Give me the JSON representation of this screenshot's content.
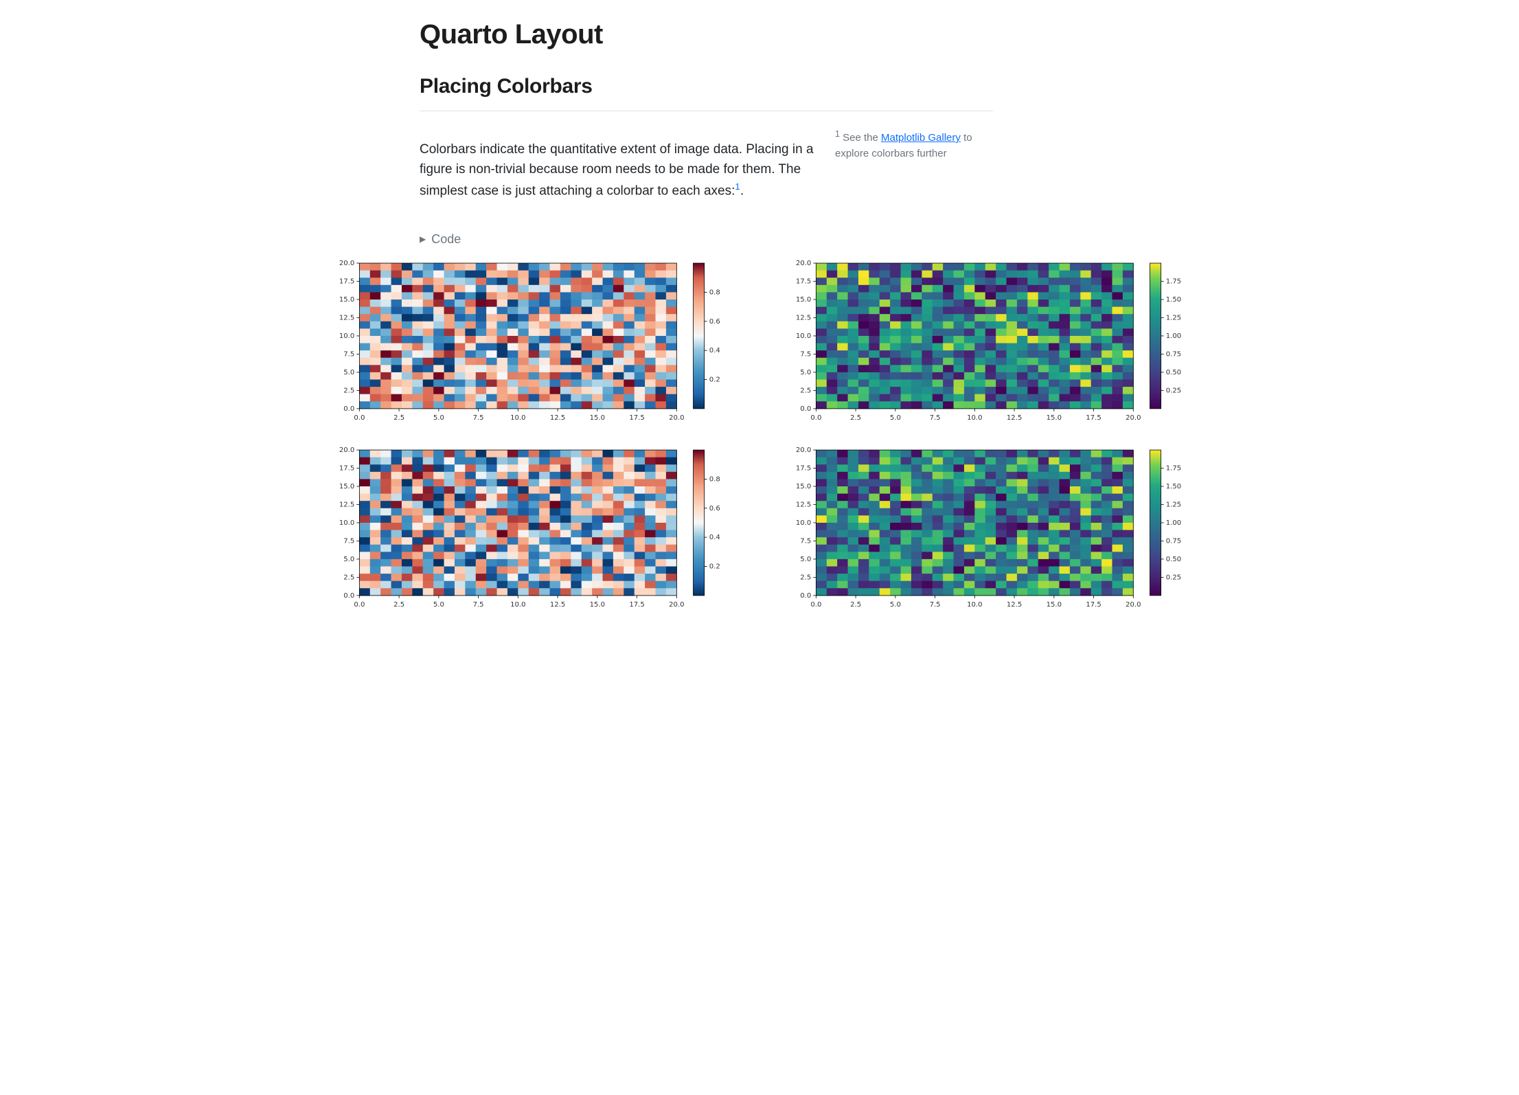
{
  "title": "Quarto Layout",
  "section": "Placing Colorbars",
  "paragraph_a": "Colorbars indicate the quantitative extent of image data. Placing in a figure is non-trivial because room needs to be made for them. The simplest case is just attaching a colorbar to each axes:",
  "footnote_marker": "1",
  "paragraph_b_after_marker": ".",
  "margin_note_prefix": "See the ",
  "margin_note_link": "Matplotlib Gallery",
  "margin_note_suffix": " to explore colorbars further",
  "code_toggle": "Code",
  "chart_data": [
    {
      "type": "heatmap",
      "position": "top-left",
      "colormap": "RdBu_r",
      "x_range": [
        0.0,
        20.0
      ],
      "y_range": [
        0.0,
        20.0
      ],
      "x_ticks": [
        "0.0",
        "2.5",
        "5.0",
        "7.5",
        "10.0",
        "12.5",
        "15.0",
        "17.5",
        "20.0"
      ],
      "y_ticks": [
        "0.0",
        "2.5",
        "5.0",
        "7.5",
        "10.0",
        "12.5",
        "15.0",
        "17.5",
        "20.0"
      ],
      "data_shape": [
        20,
        30
      ],
      "data_range": [
        0.0,
        1.0
      ],
      "colorbar_ticks": [
        "0.2",
        "0.4",
        "0.6",
        "0.8"
      ],
      "title": "",
      "xlabel": "",
      "ylabel": ""
    },
    {
      "type": "heatmap",
      "position": "top-right",
      "colormap": "viridis",
      "x_range": [
        0.0,
        20.0
      ],
      "y_range": [
        0.0,
        20.0
      ],
      "x_ticks": [
        "0.0",
        "2.5",
        "5.0",
        "7.5",
        "10.0",
        "12.5",
        "15.0",
        "17.5",
        "20.0"
      ],
      "y_ticks": [
        "0.0",
        "2.5",
        "5.0",
        "7.5",
        "10.0",
        "12.5",
        "15.0",
        "17.5",
        "20.0"
      ],
      "data_shape": [
        20,
        30
      ],
      "data_range": [
        0.0,
        2.0
      ],
      "colorbar_ticks": [
        "0.25",
        "0.50",
        "0.75",
        "1.00",
        "1.25",
        "1.50",
        "1.75"
      ],
      "title": "",
      "xlabel": "",
      "ylabel": ""
    },
    {
      "type": "heatmap",
      "position": "bottom-left",
      "colormap": "RdBu_r",
      "x_range": [
        0.0,
        20.0
      ],
      "y_range": [
        0.0,
        20.0
      ],
      "x_ticks": [
        "0.0",
        "2.5",
        "5.0",
        "7.5",
        "10.0",
        "12.5",
        "15.0",
        "17.5",
        "20.0"
      ],
      "y_ticks": [
        "0.0",
        "2.5",
        "5.0",
        "7.5",
        "10.0",
        "12.5",
        "15.0",
        "17.5",
        "20.0"
      ],
      "data_shape": [
        20,
        30
      ],
      "data_range": [
        0.0,
        1.0
      ],
      "colorbar_ticks": [
        "0.2",
        "0.4",
        "0.6",
        "0.8"
      ],
      "title": "",
      "xlabel": "",
      "ylabel": ""
    },
    {
      "type": "heatmap",
      "position": "bottom-right",
      "colormap": "viridis",
      "x_range": [
        0.0,
        20.0
      ],
      "y_range": [
        0.0,
        20.0
      ],
      "x_ticks": [
        "0.0",
        "2.5",
        "5.0",
        "7.5",
        "10.0",
        "12.5",
        "15.0",
        "17.5",
        "20.0"
      ],
      "y_ticks": [
        "0.0",
        "2.5",
        "5.0",
        "7.5",
        "10.0",
        "12.5",
        "15.0",
        "17.5",
        "20.0"
      ],
      "data_shape": [
        20,
        30
      ],
      "data_range": [
        0.0,
        2.0
      ],
      "colorbar_ticks": [
        "0.25",
        "0.50",
        "0.75",
        "1.00",
        "1.25",
        "1.50",
        "1.75"
      ],
      "title": "",
      "xlabel": "",
      "ylabel": ""
    }
  ]
}
